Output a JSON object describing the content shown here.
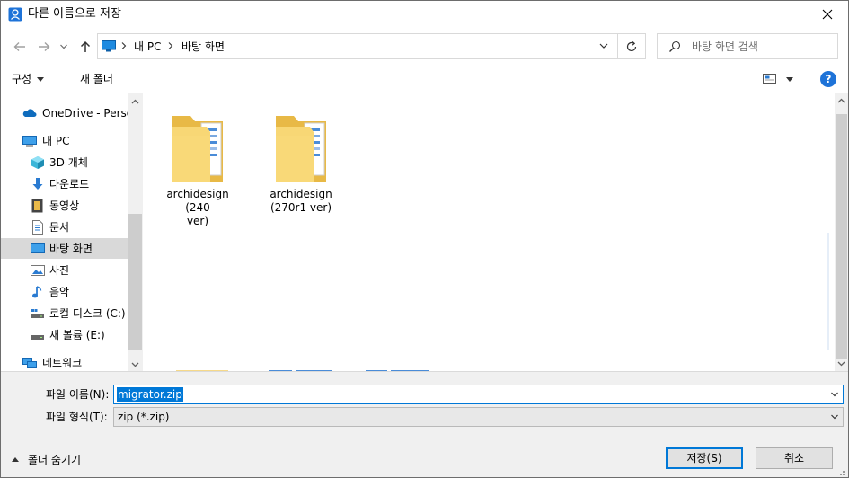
{
  "window": {
    "title": "다른 이름으로 저장"
  },
  "address": {
    "crumbs": [
      "내 PC",
      "바탕 화면"
    ],
    "search_placeholder": "바탕 화면 검색"
  },
  "toolbar": {
    "organize": "구성",
    "new_folder": "새 폴더"
  },
  "nav": {
    "items": [
      {
        "label": "OneDrive - Personal",
        "icon": "onedrive-icon"
      },
      {
        "label": "내 PC",
        "icon": "pc-icon"
      },
      {
        "label": "3D 개체",
        "icon": "3d-objects-icon"
      },
      {
        "label": "다운로드",
        "icon": "download-icon"
      },
      {
        "label": "동영상",
        "icon": "video-icon"
      },
      {
        "label": "문서",
        "icon": "document-icon"
      },
      {
        "label": "바탕 화면",
        "icon": "desktop-icon",
        "selected": true
      },
      {
        "label": "사진",
        "icon": "pictures-icon"
      },
      {
        "label": "음악",
        "icon": "music-icon"
      },
      {
        "label": "로컬 디스크 (C:)",
        "icon": "drive-icon"
      },
      {
        "label": "새 볼륨 (E:)",
        "icon": "drive-icon"
      },
      {
        "label": "네트워크",
        "icon": "network-icon"
      }
    ]
  },
  "content": {
    "folders": [
      {
        "name_line1": "archidesign (240",
        "name_line2": "ver)"
      },
      {
        "name_line1": "archidesign",
        "name_line2": "(270r1 ver)"
      }
    ]
  },
  "fields": {
    "filename_label": "파일 이름(N):",
    "filename_value": "migrator.zip",
    "filetype_label": "파일 형식(T):",
    "filetype_value": "zip (*.zip)"
  },
  "footer": {
    "hide_folders": "폴더 숨기기",
    "save": "저장(S)",
    "cancel": "취소"
  },
  "colors": {
    "accent": "#0078d7",
    "selection": "#d9d9d9",
    "folder": "#f8d775"
  }
}
